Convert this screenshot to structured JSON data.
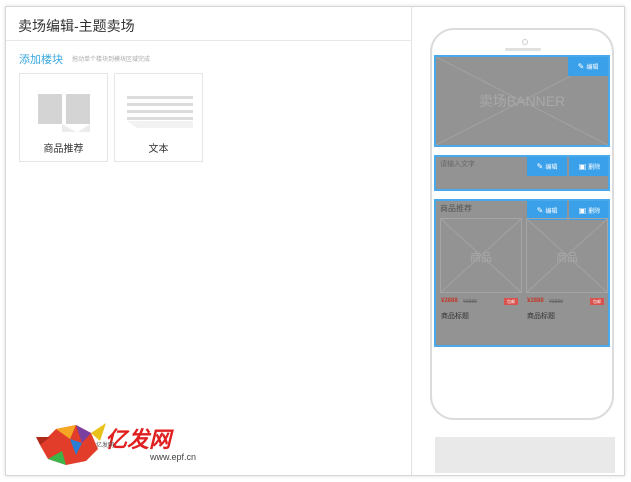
{
  "header": {
    "title": "卖场编辑-主题卖场"
  },
  "toolbar": {
    "add_module_label": "添加楼块",
    "add_hint": "拖动单个楼块到模块区域完成"
  },
  "tiles": [
    {
      "label": "商品推荐"
    },
    {
      "label": "文本"
    }
  ],
  "preview": {
    "banner": {
      "edit_label": "编辑",
      "text": "卖场BANNER"
    },
    "text_module": {
      "placeholder": "请输入文字",
      "edit_label": "编辑",
      "delete_label": "删除"
    },
    "recommend": {
      "title": "商品推荐",
      "edit_label": "编辑",
      "delete_label": "删除",
      "products": [
        {
          "image_text": "商品",
          "price": "¥2888",
          "old_price": "¥3888",
          "tag": "包邮",
          "name": "商品标题"
        },
        {
          "image_text": "商品",
          "price": "¥2888",
          "old_price": "¥3888",
          "tag": "包邮",
          "name": "商品标题"
        }
      ]
    }
  },
  "watermark": {
    "brand": "亿发网",
    "url": "www.epf.cn",
    "small": "亿发网"
  },
  "colors": {
    "accent": "#3aa0ea",
    "module_bg": "#939393",
    "module_border": "#49a9ea",
    "tag": "#d9534f"
  }
}
